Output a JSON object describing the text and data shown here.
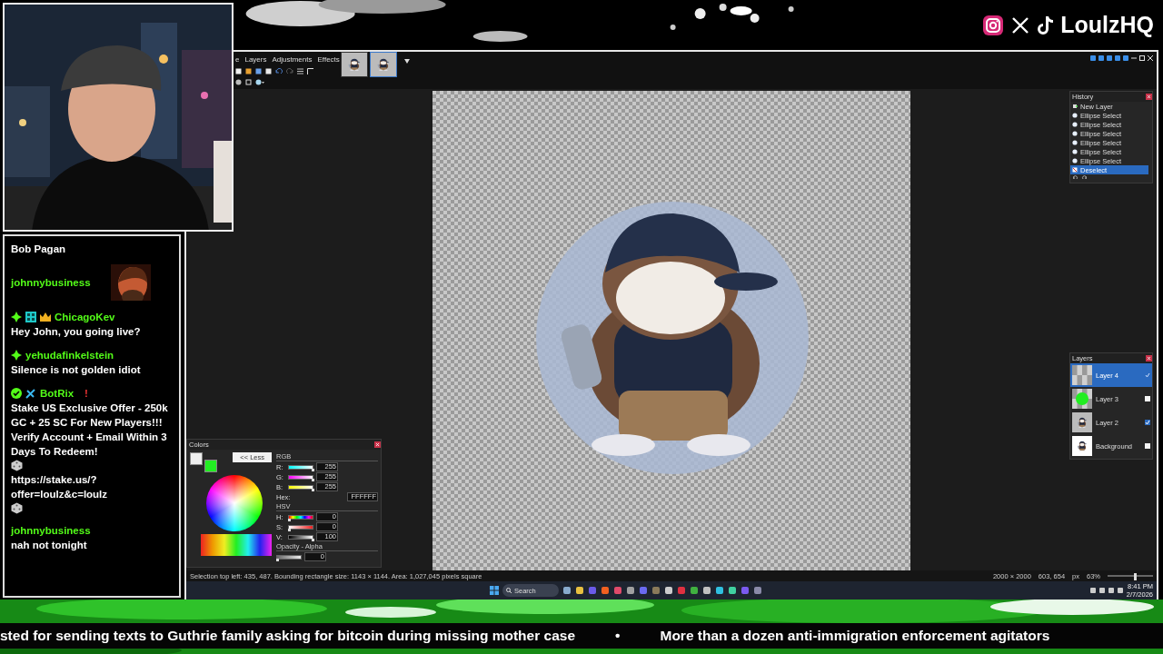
{
  "overlay": {
    "brand": "LoulzHQ"
  },
  "chat": {
    "messages": [
      {
        "parts": [
          {
            "kind": "text",
            "text": "Bob Pagan"
          }
        ]
      },
      {
        "user": "johnnybusiness",
        "parts": [
          {
            "kind": "emote"
          }
        ]
      },
      {
        "badges": [
          {
            "kind": "subscriber"
          },
          {
            "kind": "og"
          },
          {
            "kind": "vip"
          }
        ],
        "user": "ChicagoKev",
        "parts": [
          {
            "kind": "text",
            "text": "Hey John, you going live?"
          }
        ]
      },
      {
        "badges": [
          {
            "kind": "subscriber"
          }
        ],
        "user": "yehudafinkelstein",
        "parts": [
          {
            "kind": "text",
            "text": "Silence is not golden idiot"
          }
        ]
      },
      {
        "badges": [
          {
            "kind": "verified"
          },
          {
            "kind": "bot"
          }
        ],
        "user": "BotRix",
        "parts": [
          {
            "kind": "alert",
            "text": "!"
          },
          {
            "kind": "text",
            "text": "Stake US Exclusive Offer - 250k GC + 25 SC For New Players!!! Verify Account + Email Within 3 Days To Redeem!"
          },
          {
            "kind": "dice"
          },
          {
            "kind": "text",
            "text": "https://stake.us/?offer=loulz&c=loulz"
          },
          {
            "kind": "dice"
          }
        ]
      },
      {
        "user": "johnnybusiness",
        "parts": [
          {
            "kind": "text",
            "text": "nah not tonight"
          }
        ]
      }
    ]
  },
  "app": {
    "menu": [
      "e",
      "Layers",
      "Adjustments",
      "Effects"
    ],
    "image_tabs": [
      {
        "selected": false
      },
      {
        "selected": true
      }
    ],
    "history": {
      "title": "History",
      "items": [
        {
          "kind": "new-layer",
          "label": "New Layer",
          "selected": false
        },
        {
          "kind": "ellipse-select",
          "label": "Ellipse Select",
          "selected": false
        },
        {
          "kind": "ellipse-select",
          "label": "Ellipse Select",
          "selected": false
        },
        {
          "kind": "ellipse-select",
          "label": "Ellipse Select",
          "selected": false
        },
        {
          "kind": "ellipse-select",
          "label": "Ellipse Select",
          "selected": false
        },
        {
          "kind": "ellipse-select",
          "label": "Ellipse Select",
          "selected": false
        },
        {
          "kind": "ellipse-select",
          "label": "Ellipse Select",
          "selected": false
        },
        {
          "kind": "deselect",
          "label": "Deselect",
          "selected": true
        }
      ]
    },
    "layers": {
      "title": "Layers",
      "items": [
        {
          "name": "Layer 4",
          "thumbnail": {
            "kind": "empty"
          },
          "visible": true,
          "selected": true
        },
        {
          "name": "Layer 3",
          "thumbnail": {
            "kind": "circle"
          },
          "visible": false,
          "selected": false
        },
        {
          "name": "Layer 2",
          "thumbnail": {
            "kind": "art"
          },
          "visible": true,
          "selected": false
        },
        {
          "name": "Background",
          "thumbnail": {
            "kind": "art-on-white"
          },
          "visible": false,
          "selected": false
        }
      ]
    },
    "colors": {
      "title": "Colors",
      "less_button": "<< Less",
      "swatches": [
        {
          "color": "#eeeeee"
        },
        {
          "color": "#22ee22"
        }
      ],
      "rgb_heading": "RGB",
      "rgb": [
        {
          "label": "R:",
          "value": "255",
          "level": 1
        },
        {
          "label": "G:",
          "value": "255",
          "level": 1
        },
        {
          "label": "B:",
          "value": "255",
          "level": 1
        }
      ],
      "hex_label": "Hex:",
      "hex": "FFFFFF",
      "hsv_heading": "HSV",
      "hsv": [
        {
          "label": "H:",
          "value": "0",
          "level": 0
        },
        {
          "label": "S:",
          "value": "0",
          "level": 0
        },
        {
          "label": "V:",
          "value": "100",
          "level": 1
        }
      ],
      "alpha_heading": "Opacity - Alpha",
      "alpha": {
        "value": "0",
        "level": 0
      }
    },
    "status_bar": {
      "selection": "Selection top left: 435, 487. Bounding rectangle size: 1143 × 1144. Area: 1,027,045 pixels square",
      "image_size": "2000 × 2000",
      "cursor": "603, 654",
      "units": "px",
      "zoom": "63%",
      "zoom_slider": {
        "level": 0.6
      }
    },
    "taskbar": {
      "search": "Search",
      "time": "8:41 PM",
      "date": "2/7/2026"
    }
  },
  "ticker": {
    "items": [
      "sted for sending texts to Guthrie family asking for bitcoin during missing mother case",
      "More than a dozen anti-immigration enforcement agitators"
    ],
    "separator": "•"
  }
}
